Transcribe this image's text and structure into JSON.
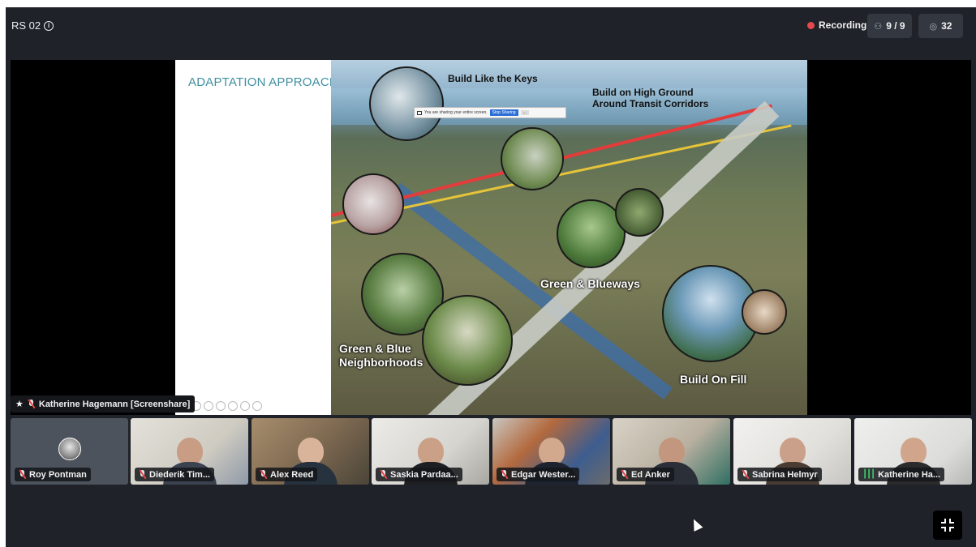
{
  "header": {
    "room_name": "RS 02",
    "recording_label": "Recording",
    "participants": "9 / 9",
    "viewers": "32",
    "colors": {
      "recording_dot": "#e5484d",
      "pill_bg": "#33373f",
      "app_bg": "#1f2228"
    }
  },
  "screenshare": {
    "owner_label": "Katherine Hagemann [Screenshare]",
    "slide": {
      "title": "ADAPTATION APPROACHES",
      "labels": {
        "keys": "Build Like the Keys",
        "high_ground_1": "Build on High Ground",
        "high_ground_2": "Around Transit Corridors",
        "blueways": "Green & Blueways",
        "neighborhoods_1": "Green & Blue",
        "neighborhoods_2": "Neighborhoods",
        "fill": "Build On Fill"
      },
      "share_notice": {
        "text": "You are sharing your entire screen.",
        "stop_label": "Stop Sharing",
        "more_label": "..."
      }
    }
  },
  "participants": [
    {
      "name": "Roy Pontman",
      "mic": "muted",
      "video": false
    },
    {
      "name": "Diederik Tim...",
      "mic": "muted",
      "video": true
    },
    {
      "name": "Alex Reed",
      "mic": "muted",
      "video": true
    },
    {
      "name": "Saskia Pardaa...",
      "mic": "muted",
      "video": true
    },
    {
      "name": "Edgar Wester...",
      "mic": "muted",
      "video": true
    },
    {
      "name": "Ed Anker",
      "mic": "muted",
      "video": true
    },
    {
      "name": "Sabrina Helmyr",
      "mic": "muted",
      "video": true
    },
    {
      "name": "Katherine Ha...",
      "mic": "speaking",
      "video": true
    }
  ],
  "icons": {
    "info": "info-icon",
    "participants": "people-icon",
    "viewers": "eye-icon",
    "pin": "pin-icon",
    "mic_off": "mic-off-icon",
    "speaking": "speaking-icon",
    "minimize": "minimize-icon"
  }
}
